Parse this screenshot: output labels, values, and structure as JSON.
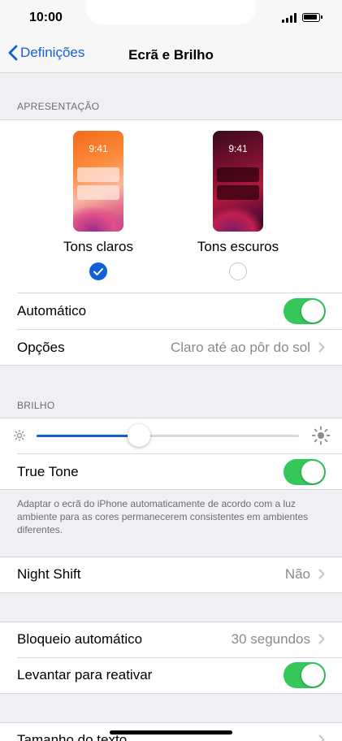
{
  "status": {
    "time": "10:00"
  },
  "nav": {
    "back_label": "Definições",
    "title": "Ecrã e Brilho"
  },
  "appearance": {
    "header": "APRESENTAÇÃO",
    "light": {
      "label": "Tons claros",
      "preview_time": "9:41",
      "selected": true
    },
    "dark": {
      "label": "Tons escuros",
      "preview_time": "9:41",
      "selected": false
    },
    "automatic_label": "Automático",
    "automatic_on": true,
    "options_label": "Opções",
    "options_value": "Claro até ao pôr do sol"
  },
  "brightness": {
    "header": "BRILHO",
    "level": 0.39,
    "true_tone_label": "True Tone",
    "true_tone_on": true,
    "true_tone_footer": "Adaptar o ecrã do iPhone automaticamente de acordo com a luz ambiente para as cores permanecerem consistentes em ambientes diferentes."
  },
  "night_shift": {
    "label": "Night Shift",
    "value": "Não"
  },
  "lock": {
    "auto_lock_label": "Bloqueio automático",
    "auto_lock_value": "30 segundos",
    "raise_to_wake_label": "Levantar para reativar",
    "raise_to_wake_on": true
  },
  "text_size": {
    "label": "Tamanho do texto"
  },
  "colors": {
    "accent": "#1260d6",
    "toggle_on": "#34c759"
  },
  "icons": [
    "chevron-left-icon",
    "chevron-right-icon",
    "checkmark-icon",
    "sun-small-icon",
    "sun-large-icon",
    "signal-icon",
    "battery-icon"
  ]
}
